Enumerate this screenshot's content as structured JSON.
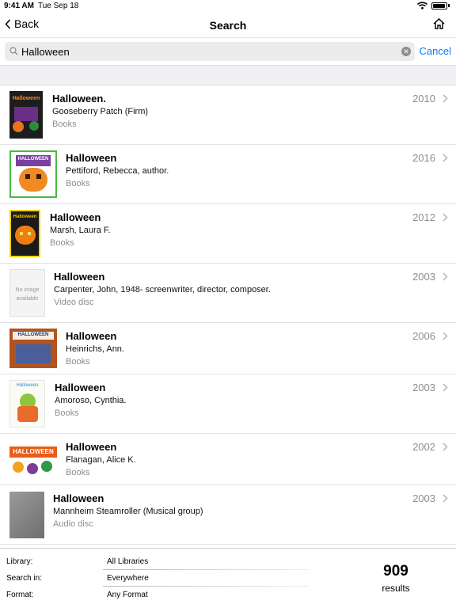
{
  "status_bar": {
    "time": "9:41 AM",
    "date": "Tue Sep 18",
    "icons": [
      "wifi-icon",
      "battery-icon"
    ]
  },
  "nav": {
    "back_label": "Back",
    "title": "Search",
    "home_icon": "home-icon"
  },
  "search": {
    "value": "Halloween",
    "placeholder": "",
    "cancel_label": "Cancel"
  },
  "colors": {
    "accent": "#0a7bff",
    "secondary_text": "#8e8e93",
    "section_bg": "#efeff4"
  },
  "results": [
    {
      "title": "Halloween.",
      "author": "Gooseberry Patch (Firm)",
      "format": "Books",
      "year": "2010",
      "cover_label": "Halloween"
    },
    {
      "title": "Halloween",
      "author": "Pettiford, Rebecca, author.",
      "format": "Books",
      "year": "2016",
      "cover_label": "HALLOWEEN"
    },
    {
      "title": "Halloween",
      "author": "Marsh, Laura F.",
      "format": "Books",
      "year": "2012",
      "cover_label": "Halloween"
    },
    {
      "title": "Halloween",
      "author": "Carpenter, John, 1948- screenwriter, director, composer.",
      "format": "Video disc",
      "year": "2003",
      "cover_label": "No image available"
    },
    {
      "title": "Halloween",
      "author": "Heinrichs, Ann.",
      "format": "Books",
      "year": "2006",
      "cover_label": "HALLOWEEN"
    },
    {
      "title": "Halloween",
      "author": "Amoroso, Cynthia.",
      "format": "Books",
      "year": "2003",
      "cover_label": "Halloween"
    },
    {
      "title": "Halloween",
      "author": "Flanagan, Alice K.",
      "format": "Books",
      "year": "2002",
      "cover_label": "HALLOWEEN"
    },
    {
      "title": "Halloween",
      "author": "Mannheim Steamroller (Musical group)",
      "format": "Audio disc",
      "year": "2003",
      "cover_label": ""
    }
  ],
  "footer": {
    "library_label": "Library:",
    "library_value": "All Libraries",
    "search_in_label": "Search in:",
    "search_in_value": "Everywhere",
    "format_label": "Format:",
    "format_value": "Any Format",
    "result_count": "909",
    "result_count_label": "results"
  }
}
